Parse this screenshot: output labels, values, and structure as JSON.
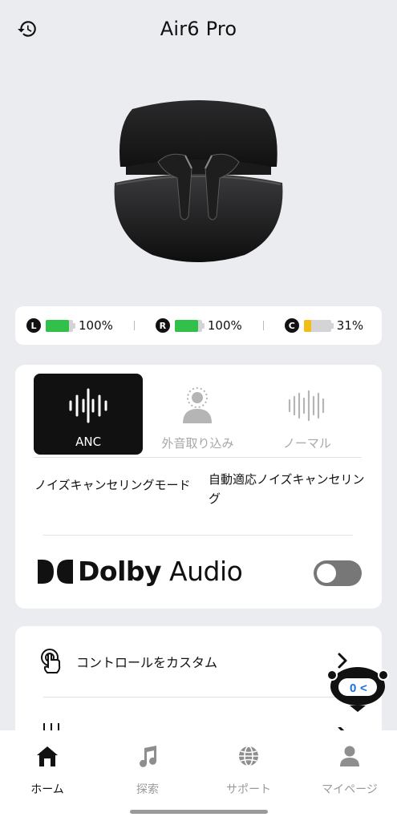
{
  "header": {
    "title": "Air6 Pro"
  },
  "battery": [
    {
      "badge": "L",
      "percent_text": "100%",
      "level": 1.0,
      "color": "#31c04a"
    },
    {
      "badge": "R",
      "percent_text": "100%",
      "level": 1.0,
      "color": "#31c04a"
    },
    {
      "badge": "C",
      "percent_text": "31%",
      "level": 0.31,
      "color": "#f4bd13"
    }
  ],
  "modes": {
    "items": [
      {
        "label": "ANC",
        "icon": "waveform-icon",
        "active": true
      },
      {
        "label": "外音取り込み",
        "icon": "ambient-person-icon",
        "active": false
      },
      {
        "label": "ノーマル",
        "icon": "normal-wave-icon",
        "active": false
      }
    ]
  },
  "noise_cancel": {
    "label": "ノイズキャンセリングモード",
    "value": "自動適応ノイズキャンセリング"
  },
  "dolby": {
    "brand": "Dolby",
    "product": "Audio",
    "enabled": false
  },
  "controls": {
    "custom_label": "コントロールをカスタム"
  },
  "tabbar": {
    "tabs": [
      {
        "label": "ホーム",
        "icon": "home-icon",
        "active": true
      },
      {
        "label": "探索",
        "icon": "music-note-icon",
        "active": false
      },
      {
        "label": "サポート",
        "icon": "globe-icon",
        "active": false
      },
      {
        "label": "マイページ",
        "icon": "person-icon",
        "active": false
      }
    ]
  },
  "colors": {
    "accent": "#111111",
    "battery_full": "#31c04a",
    "battery_low": "#f4bd13",
    "toggle_off": "#777777"
  }
}
